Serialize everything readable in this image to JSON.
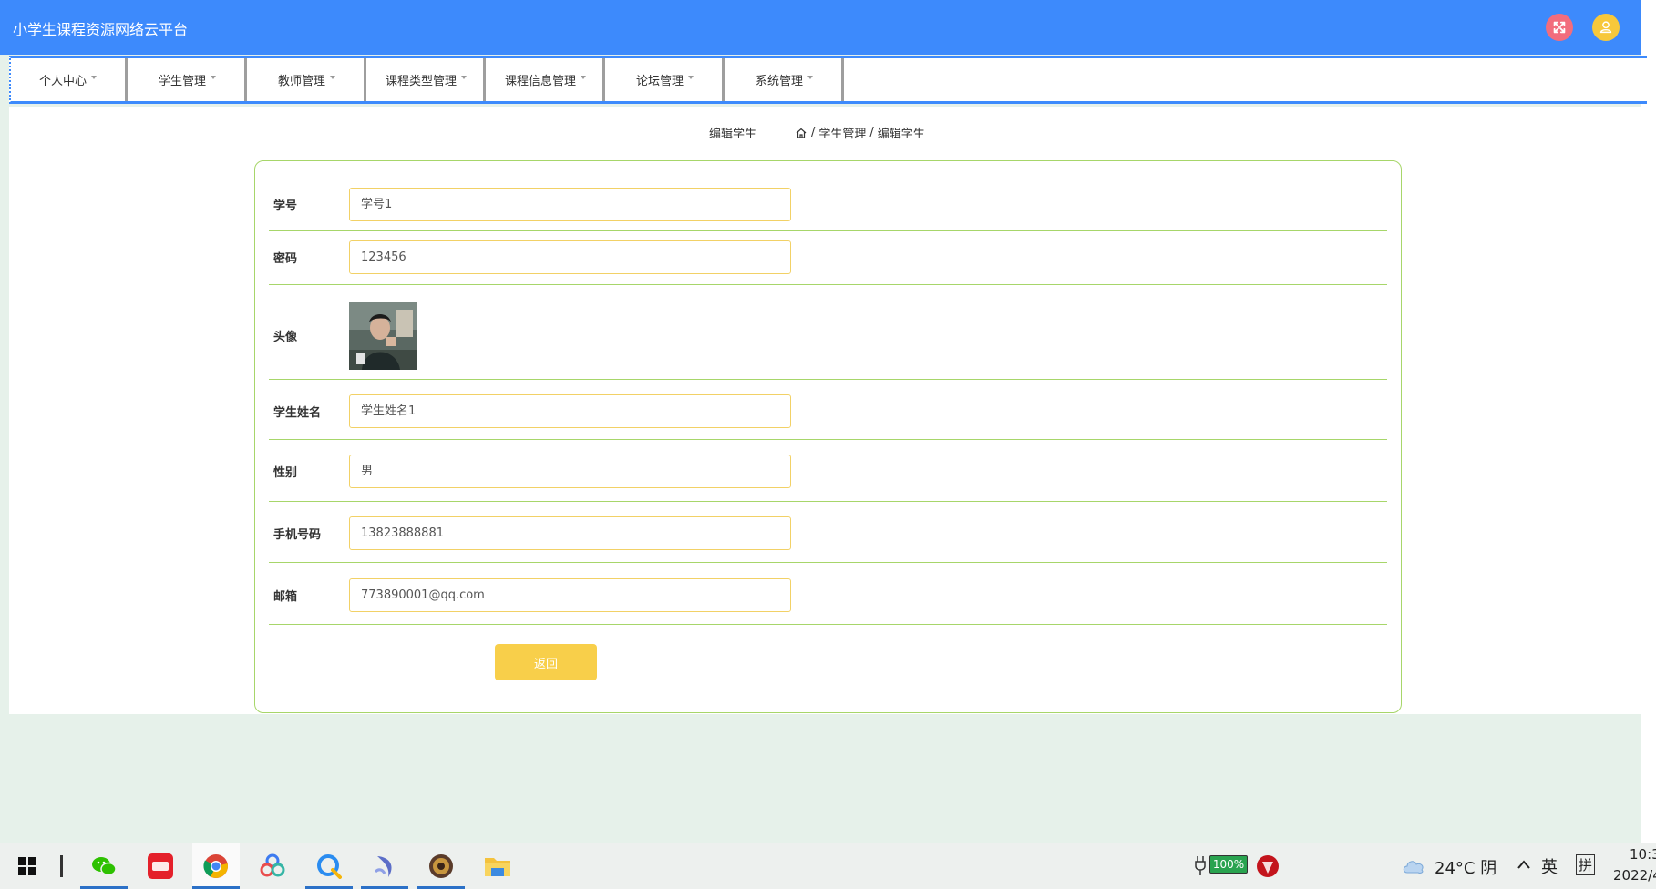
{
  "header": {
    "app_title": "小学生课程资源网络云平台",
    "icons": [
      "fullscreen-icon",
      "user-icon"
    ]
  },
  "nav": {
    "items": [
      {
        "label": "个人中心"
      },
      {
        "label": "学生管理"
      },
      {
        "label": "教师管理"
      },
      {
        "label": "课程类型管理"
      },
      {
        "label": "课程信息管理"
      },
      {
        "label": "论坛管理"
      },
      {
        "label": "系统管理"
      }
    ]
  },
  "page": {
    "title": "编辑学生",
    "breadcrumb": [
      "学生管理",
      "编辑学生"
    ],
    "breadcrumb_sep": "/"
  },
  "form": {
    "fields": [
      {
        "label": "学号",
        "value": "学号1"
      },
      {
        "label": "密码",
        "value": "123456"
      },
      {
        "label": "头像",
        "type": "image"
      },
      {
        "label": "学生姓名",
        "value": "学生姓名1"
      },
      {
        "label": "性别",
        "value": "男"
      },
      {
        "label": "手机号码",
        "value": "13823888881"
      },
      {
        "label": "邮箱",
        "value": "773890001@qq.com"
      }
    ],
    "return_label": "返回"
  },
  "taskbar": {
    "apps": [
      "windows-start-icon",
      "task-view-icon",
      "wechat-icon",
      "youdao-icon",
      "chrome-icon",
      "app-icon",
      "qq-browser-icon",
      "dolphin-icon",
      "game-icon",
      "file-explorer-icon"
    ],
    "battery": "100%",
    "weather": "24°C 阴",
    "ime": "英",
    "ime_mode": "拼",
    "time": "10:3",
    "date": "2022/4",
    "colors": {
      "accent": "#3d8afc",
      "border": "#a7d66a",
      "input_border": "#f2d166",
      "button": "#f8cf4a"
    }
  }
}
